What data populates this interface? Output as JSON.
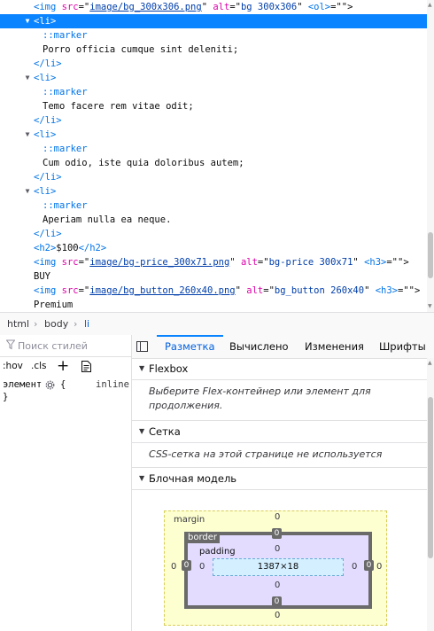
{
  "markup": {
    "line0": {
      "tag_open": "<img",
      "attr_src": "src",
      "src_val": "image/bg_300x306.png",
      "attr_alt": "alt",
      "alt_val": "bg 300x306",
      "tail_tag": "<ol>"
    },
    "line1": {
      "text": "<li>"
    },
    "line2": {
      "text": "::marker"
    },
    "line3": {
      "text": "Porro officia cumque sint deleniti;"
    },
    "line4": {
      "text": "</li>"
    },
    "line5": {
      "text": "<li>"
    },
    "line6": {
      "text": "::marker"
    },
    "line7": {
      "text": "Temo facere rem vitae odit;"
    },
    "line8": {
      "text": "</li>"
    },
    "line9": {
      "text": "<li>"
    },
    "line10": {
      "text": "::marker"
    },
    "line11": {
      "text": "Cum odio, iste quia doloribus autem;"
    },
    "line12": {
      "text": "</li>"
    },
    "line13": {
      "text": "<li>"
    },
    "line14": {
      "text": "::marker"
    },
    "line15": {
      "text": "Aperiam nulla ea neque."
    },
    "line16": {
      "text": "</li>"
    },
    "line17": {
      "open": "<h2>",
      "text": "$100",
      "close": "</h2>"
    },
    "line18": {
      "tag_open": "<img",
      "attr_src": "src",
      "src_val": "image/bg-price_300x71.png",
      "attr_alt": "alt",
      "alt_val": "bg-price 300x71",
      "tail_tag": "<h3>"
    },
    "line19": {
      "text": "BUY"
    },
    "line20": {
      "tag_open": "<img",
      "attr_src": "src",
      "src_val": "image/bg_button_260x40.png",
      "attr_alt": "alt",
      "alt_val": "bg_button 260x40",
      "tail_tag": "<h3>"
    },
    "line21": {
      "text": "Premium"
    }
  },
  "breadcrumb": {
    "items": [
      "html",
      "body",
      "li"
    ]
  },
  "rules": {
    "filter_placeholder": "Поиск стилей",
    "hov": ":hov",
    "cls": ".cls",
    "plus": "+",
    "element_label": "элемент",
    "open_brace": "{",
    "display_value": "inline",
    "close_brace": "}"
  },
  "layout": {
    "tabs": [
      "Разметка",
      "Вычислено",
      "Изменения",
      "Шрифты"
    ],
    "flexbox_heading": "Flexbox",
    "flexbox_message": "Выберите Flex-контейнер или элемент для продолжения.",
    "grid_heading": "Сетка",
    "grid_message": "CSS-сетка на этой странице не используется",
    "boxmodel_heading": "Блочная модель",
    "box": {
      "margin_label": "margin",
      "border_label": "border",
      "padding_label": "padding",
      "content_size": "1387×18",
      "margin_top": "0",
      "margin_bottom": "0",
      "margin_left": "0",
      "margin_right": "0",
      "border_top": "0",
      "border_bottom": "0",
      "border_left": "0",
      "border_right": "0",
      "padding_top": "0",
      "padding_bottom": "0",
      "padding_left": "0",
      "padding_right": "0"
    }
  },
  "colors": {
    "selection": "#0a84ff",
    "tag": "#0074e8",
    "attr": "#dd00a9",
    "value": "#003eaa"
  }
}
